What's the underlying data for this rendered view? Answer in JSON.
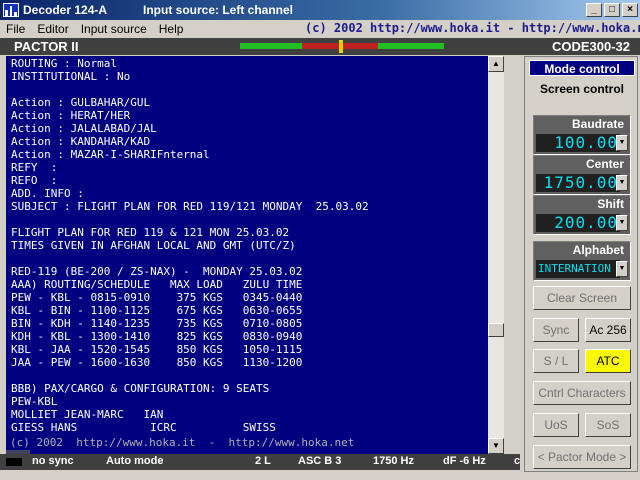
{
  "window": {
    "app_title": "Decoder 124-A",
    "source_title": "Input source: Left channel",
    "controls": [
      "_",
      "□",
      "×"
    ]
  },
  "menu": {
    "items": [
      "File",
      "Editor",
      "Input source",
      "Help"
    ],
    "copyright": "(c) 2002  http://www.hoka.it  -  http://www.hoka.net"
  },
  "mode_bar": {
    "left": "PACTOR II",
    "right": "CODE300-32"
  },
  "decoded_text": "ROUTING : Normal\nINSTITUTIONAL : No\n\nAction : GULBAHAR/GUL\nAction : HERAT/HER\nAction : JALALABAD/JAL\nAction : KANDAHAR/KAD\nAction : MAZAR-I-SHARIFnternal\nREFY  :\nREFO  :\nADD. INFO :\nSUBJECT : FLIGHT PLAN FOR RED 119/121 MONDAY  25.03.02\n\nFLIGHT PLAN FOR RED 119 & 121 MON 25.03.02\nTIMES GIVEN IN AFGHAN LOCAL AND GMT (UTC/Z)\n\nRED-119 (BE-200 / ZS-NAX) -  MONDAY 25.03.02\nAAA) ROUTING/SCHEDULE   MAX LOAD   ZULU TIME\nPEW - KBL - 0815-0910    375 KGS   0345-0440\nKBL - BIN - 1100-1125    675 KGS   0630-0655\nBIN - KDH - 1140-1235    735 KGS   0710-0805\nKDH - KBL - 1300-1410    825 KGS   0830-0940\nKBL - JAA - 1520-1545    850 KGS   1050-1115\nJAA - PEW - 1600-1630    850 KGS   1130-1200\n\nBBB) PAX/CARGO & CONFIGURATION: 9 SEATS\nPEW-KBL\nMOLLIET JEAN-MARC   IAN\nGIESS HANS           ICRC          SWISS",
  "watermark": "(c) 2002  http://www.hoka.it  -  http://www.hoka.net",
  "status": {
    "sync": "no sync",
    "mode": "Auto mode",
    "lines": "2 L",
    "asc": "ASC B 3",
    "freq": "1750 Hz",
    "df": "dF -6 Hz",
    "extra": "c"
  },
  "panel": {
    "mode_tab": "Mode control",
    "screen_tab": "Screen control",
    "baudrate_label": "Baudrate",
    "baudrate_value": "100.00",
    "center_label": "Center",
    "center_value": "1750.00",
    "shift_label": "Shift",
    "shift_value": "200.00",
    "alphabet_label": "Alphabet",
    "alphabet_value": "INTERNATION",
    "clear_screen": "Clear Screen",
    "sync": "Sync",
    "ac256": "Ac 256",
    "sl": "S / L",
    "atc": "ATC",
    "cntrl_characters": "Cntrl Characters",
    "uos": "UoS",
    "sos": "SoS",
    "pactor_mode": "< Pactor Mode >"
  }
}
